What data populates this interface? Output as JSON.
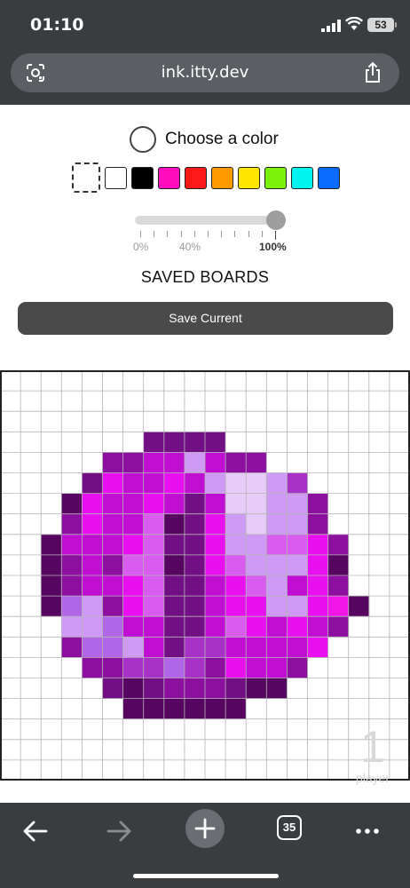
{
  "status_bar": {
    "time": "01:10",
    "battery": "53"
  },
  "browser": {
    "url": "ink.itty.dev",
    "tab_count": "35"
  },
  "color_picker": {
    "label": "Choose a color",
    "swatches": [
      "none",
      "#ffffff",
      "#000000",
      "#ff0dbf",
      "#ff1a1a",
      "#ff9a00",
      "#ffe600",
      "#7cf10a",
      "#00f5f0",
      "#0a6cff"
    ]
  },
  "opacity_slider": {
    "value": 1.0,
    "labels": [
      "0%",
      "40%",
      "100%"
    ]
  },
  "saved_boards": {
    "title": "SAVED BOARDS",
    "save_label": "Save Current"
  },
  "board": {
    "grid_size": 20,
    "palette": {
      "a": "#560660",
      "b": "#8c0fa0",
      "c": "#c00fd2",
      "d": "#e810f0",
      "e": "#d85cf0",
      "f": "#cf9af5",
      "g": "#e6ccf7",
      "h": "#720f84",
      "i": "#a832c8",
      "j": "#b066e6",
      "k": "#f015e8"
    },
    "rows": [
      "....................",
      "....................",
      "....................",
      ".......hhhh.........",
      ".....bbccfcbb.......",
      "....hdccdcfggfi.....",
      "...adccdchcggffb....",
      "...bdcceahdfgffb....",
      "..acccdehhdffeedb...",
      "..abcbeeahdefffda...",
      "..abccdehhcdefcdb...",
      "..ajfbdehhcddffdka..",
      "...ffjcchhcedcdcb...",
      "...bjjfchiiccccd....",
      "....bbiijibdccb.....",
      ".....hahbbbhaa......",
      "......aaaaaa........",
      "....................",
      "....................",
      "...................."
    ]
  },
  "player": {
    "number": "1",
    "label": "player"
  }
}
